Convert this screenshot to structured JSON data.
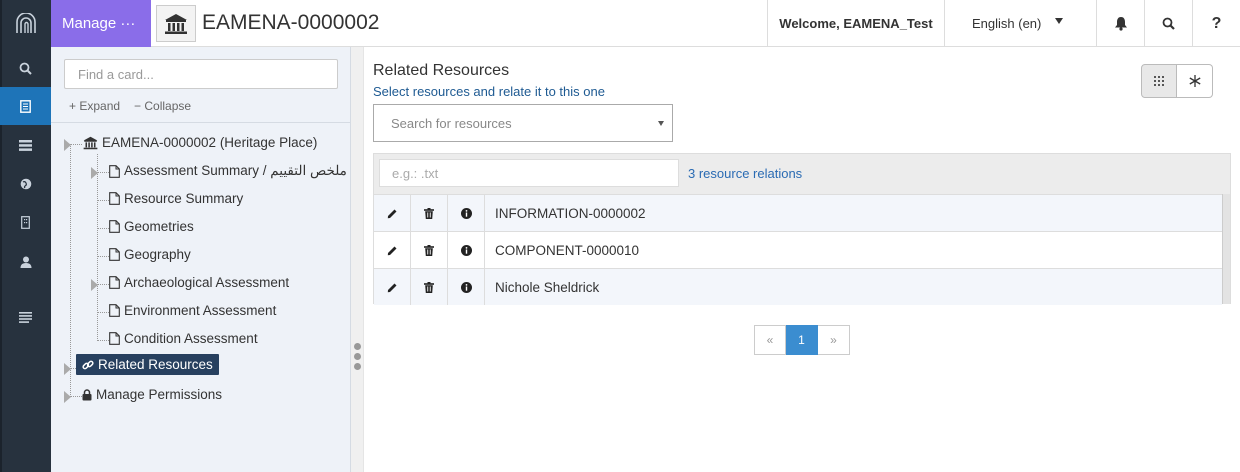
{
  "header": {
    "manage_label": "Manage ···",
    "resource_title": "EAMENA-0000002",
    "welcome": "Welcome, EAMENA_Test",
    "language": "English (en)",
    "help": "?"
  },
  "rail": {
    "items": [
      "search-icon",
      "resource-editor-icon",
      "list-icon",
      "globe-icon",
      "building-icon",
      "user-icon",
      "menu-icon"
    ],
    "active": "resource-editor-icon",
    "accent": "#1e74b8",
    "background": "#27323e"
  },
  "sidebar": {
    "find_placeholder": "Find a card...",
    "expand_label": "+ Expand",
    "collapse_label": "− Collapse",
    "root_label": "EAMENA-0000002 (Heritage Place)",
    "cards": [
      {
        "label": "Assessment Summary / ملخص التقييم",
        "expandable": true
      },
      {
        "label": "Resource Summary",
        "expandable": false
      },
      {
        "label": "Geometries",
        "expandable": false
      },
      {
        "label": "Geography",
        "expandable": false
      },
      {
        "label": "Archaeological Assessment",
        "expandable": true
      },
      {
        "label": "Environment Assessment",
        "expandable": false
      },
      {
        "label": "Condition Assessment",
        "expandable": false
      }
    ],
    "related_label": "Related Resources",
    "permissions_label": "Manage Permissions"
  },
  "main": {
    "title": "Related Resources",
    "subtitle": "Select resources and relate it to this one",
    "search_placeholder": "Search for resources",
    "filter_placeholder": "e.g.: .txt",
    "relations_count": "3 resource relations",
    "rows": [
      {
        "name": "INFORMATION-0000002"
      },
      {
        "name": "COMPONENT-0000010"
      },
      {
        "name": "Nichole Sheldrick"
      }
    ],
    "pager": {
      "prev": "«",
      "current": "1",
      "next": "»"
    }
  },
  "colors": {
    "manage_button": "#8a6de9",
    "highlight": "#27405f",
    "link": "#2a6bb3",
    "pager_active": "#3b8dd0"
  }
}
